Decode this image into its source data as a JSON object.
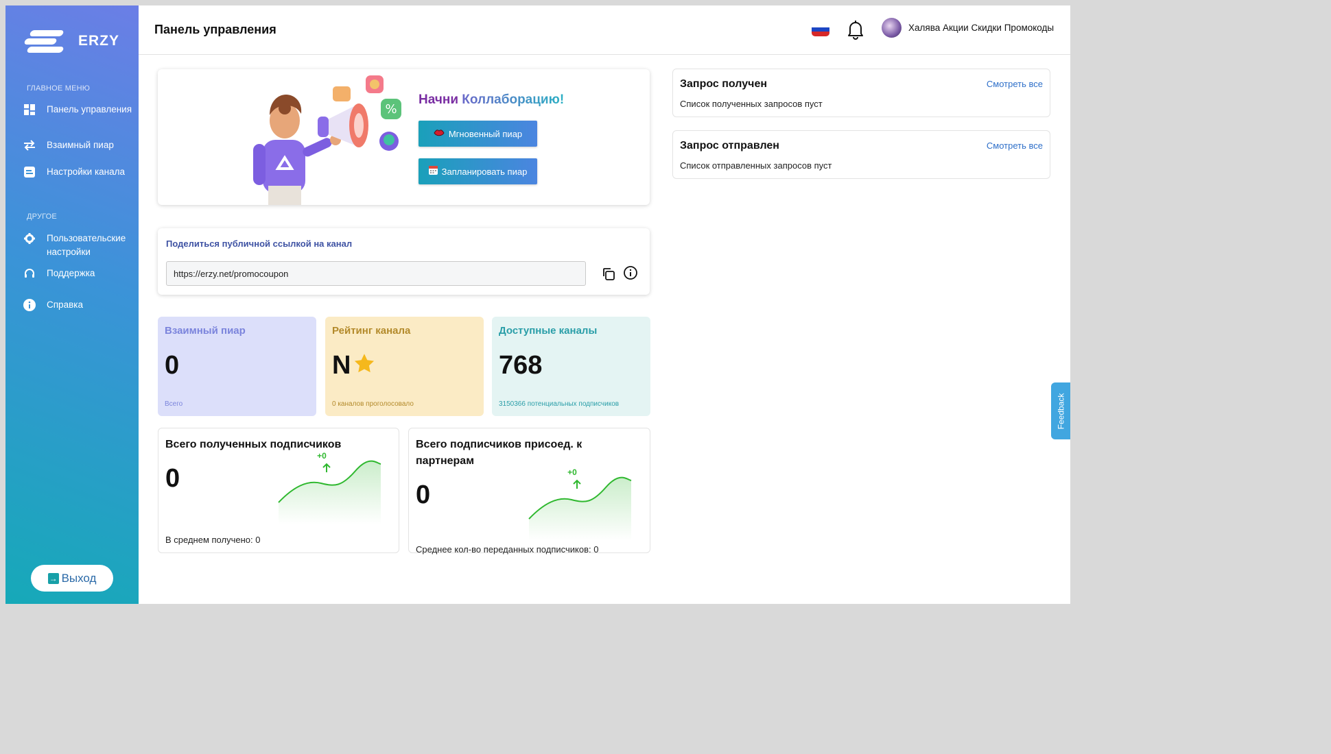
{
  "brand": {
    "name": "ERZY"
  },
  "sidebar": {
    "main_section": "ГЛАВНОЕ МЕНЮ",
    "main_items": [
      {
        "label": "Панель управления",
        "icon": "dashboard-icon"
      },
      {
        "label": "Взаимный пиар",
        "icon": "swap-arrows-icon"
      },
      {
        "label": "Настройки канала",
        "icon": "channel-settings-icon"
      }
    ],
    "other_section": "ДРУГОЕ",
    "other_items": [
      {
        "label": "Пользовательские настройки",
        "icon": "gear-icon"
      },
      {
        "label": "Поддержка",
        "icon": "headset-icon"
      },
      {
        "label": "Справка",
        "icon": "info-icon"
      }
    ],
    "logout_label": "Выход"
  },
  "header": {
    "title": "Панель управления",
    "user_name": "Халява Акции Скидки Промокоды"
  },
  "hero": {
    "title_part1": "Начни",
    "title_part2": "Коллаборацию!",
    "instant_button": "Мгновенный пиар",
    "schedule_button": "Запланировать пиар"
  },
  "share": {
    "title": "Поделиться публичной ссылкой на канал",
    "url": "https://erzy.net/promocoupon"
  },
  "stats": [
    {
      "label": "Взаимный пиар",
      "value": "0",
      "sub": "Всего",
      "bg": "#dcdffa",
      "color": "#7b84dc"
    },
    {
      "label": "Рейтинг канала",
      "value": "N",
      "sub": "0 каналов проголосовало",
      "bg": "#fbebc5",
      "color": "#b38a2b"
    },
    {
      "label": "Доступные каналы",
      "value": "768",
      "sub": "3150366 потенциальных подписчиков",
      "bg": "#e4f4f3",
      "color": "#2a9ea8"
    }
  ],
  "subscribers": {
    "received_title": "Всего полученных подписчиков",
    "received_value": "0",
    "received_delta": "+0",
    "received_foot": "В среднем получено: 0",
    "joined_title": "Всего подписчиков присоед. к партнерам",
    "joined_value": "0",
    "joined_delta": "+0",
    "joined_foot": "Среднее кол-во переданных подписчиков: 0"
  },
  "requests": {
    "received_title": "Запрос получен",
    "received_link": "Смотреть все",
    "received_text": "Список полученных запросов пуст",
    "sent_title": "Запрос отправлен",
    "sent_link": "Смотреть все",
    "sent_text": "Список отправленных запросов пуст"
  },
  "feedback_label": "Feedback",
  "colors": {
    "accent_green": "#2fb82f",
    "link_blue": "#2e6fc9"
  }
}
